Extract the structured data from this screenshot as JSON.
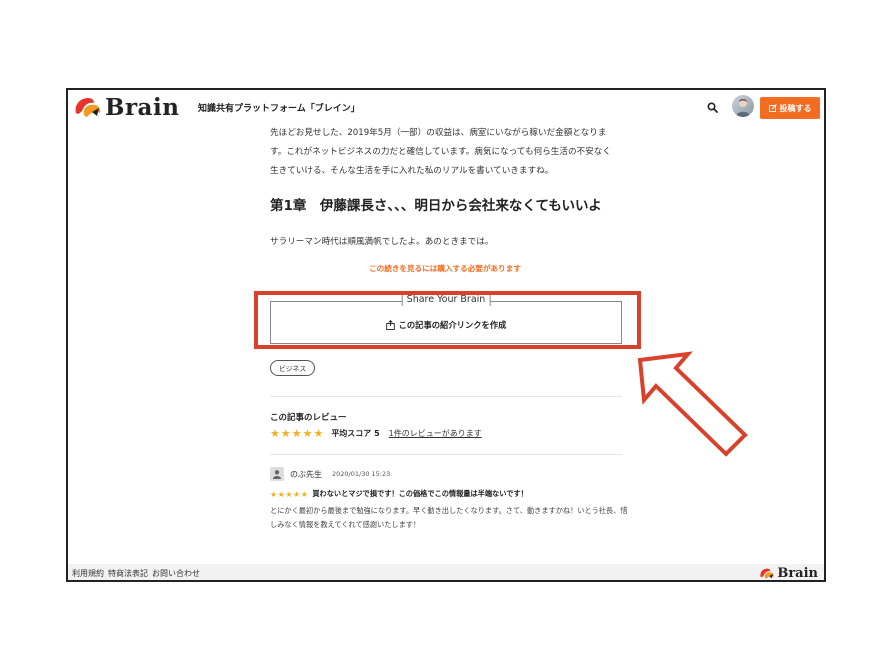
{
  "header": {
    "logo_text": "Brain",
    "tagline": "知識共有プラットフォーム「ブレイン」",
    "post_button": "投稿する"
  },
  "article": {
    "intro_lines": [
      "先ほどお見せした、2019年5月（一部）の収益は、病室にいながら稼いだ金額となりま",
      "す。これがネットビジネスの力だと確信しています。病気になっても何ら生活の不安なく",
      "生きていける、そんな生活を手に入れた私のリアルを書いていきますね。"
    ],
    "chapter_title": "第1章　伊藤課長さ、、、明日から会社来なくてもいいよ",
    "paragraph": "サラリーマン時代は順風満帆でしたよ。あのときまでは。",
    "buy_note": "この続きを見るには購入する必要があります"
  },
  "share": {
    "legend": "Share Your Brain",
    "link_label": "この記事の紹介リンクを作成"
  },
  "tag": "ビジネス",
  "reviews": {
    "title": "この記事のレビュー",
    "stars": "★★★★★",
    "score_label": "平均スコア 5",
    "count_label": "1件のレビューがあります",
    "average": 5,
    "items": [
      {
        "name": "のぶ先生",
        "date": "2020/01/30 15:23",
        "stars": "★★★★★",
        "headline": "買わないとマジで損です！この価格でこの情報量は半端ないです！",
        "body": "とにかく最初から最後まで勉強になります。早く動き出したくなります。さて、動きますかね！いとう社長、惜しみなく情報を教えてくれて感謝いたします！"
      }
    ]
  },
  "footer": {
    "links": [
      "利用規約",
      "特商法表記",
      "お問い合わせ"
    ],
    "logo_text": "Brain"
  },
  "colors": {
    "brand_orange": "#f36c21",
    "highlight_red": "#d9412b",
    "star_gold": "#f2b01e"
  },
  "icons": [
    "search-icon",
    "avatar",
    "edit-icon",
    "share-icon",
    "user-icon",
    "arrow-annotation"
  ]
}
